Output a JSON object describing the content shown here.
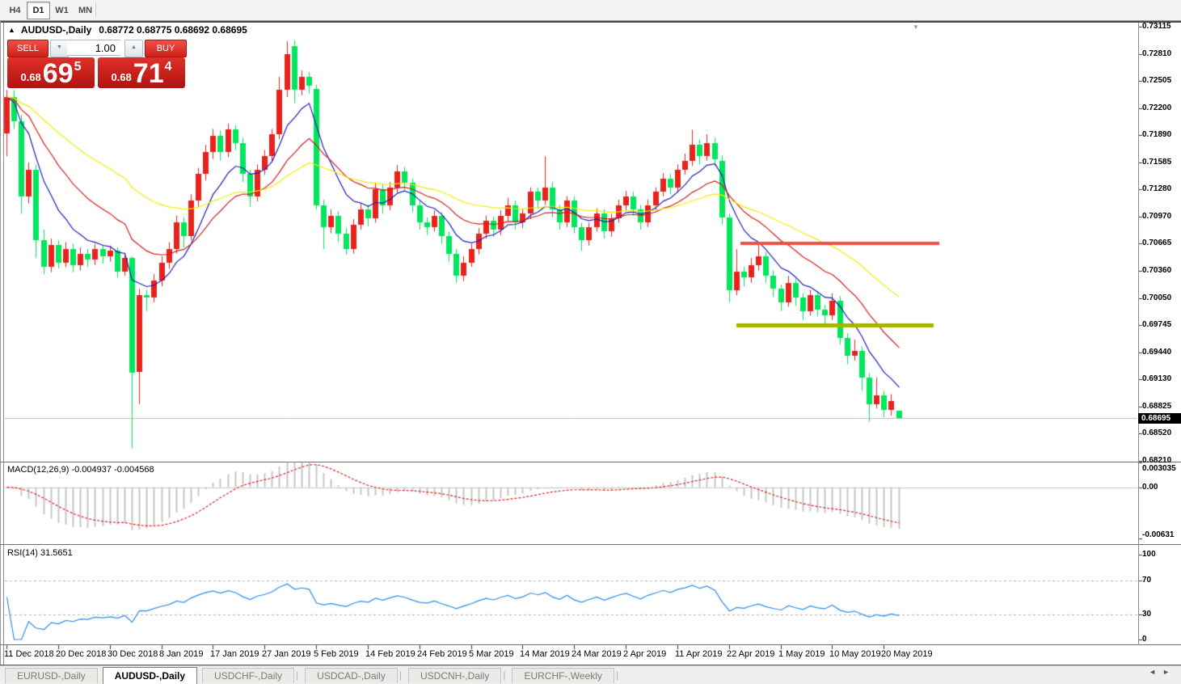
{
  "toolbar": {
    "timeframes": [
      {
        "label": "H4",
        "active": false
      },
      {
        "label": "D1",
        "active": true
      },
      {
        "label": "W1",
        "active": false
      },
      {
        "label": "MN",
        "active": false
      }
    ]
  },
  "chart": {
    "title": "AUDUSD-,Daily",
    "ohlc_text": "0.68772 0.68775 0.68692 0.68695",
    "collapse_icon": "▲",
    "autoscroll_icon": "▼",
    "trade_widget": {
      "sell_label": "SELL",
      "buy_label": "BUY",
      "volume": "1.00",
      "spin_down_icon": "▼",
      "spin_up_icon": "▲",
      "sell_price": "0.68695",
      "buy_price": "0.68714",
      "sell_small": "0.68",
      "sell_big": "69",
      "sell_sup": "5",
      "buy_small": "0.68",
      "buy_big": "71",
      "buy_sup": "4"
    },
    "price_axis": {
      "ticks": [
        "0.73115",
        "0.72810",
        "0.72505",
        "0.72200",
        "0.71890",
        "0.71585",
        "0.71280",
        "0.70970",
        "0.70665",
        "0.70360",
        "0.70050",
        "0.69745",
        "0.69440",
        "0.69130",
        "0.68825",
        "0.68520",
        "0.68210"
      ],
      "current": "0.68695"
    }
  },
  "macd_panel": {
    "label": "MACD(12,26,9) -0.004937 -0.004568",
    "axis_labels": [
      "0.003035",
      "0.00",
      "-0.00631"
    ]
  },
  "rsi_panel": {
    "label": "RSI(14) 31.5651",
    "axis_labels": [
      "100",
      "70",
      "30",
      "0"
    ]
  },
  "tabs": {
    "items": [
      {
        "label": "EURUSD-,Daily",
        "active": false
      },
      {
        "label": "AUDUSD-,Daily",
        "active": true
      },
      {
        "label": "USDCHF-,Daily",
        "active": false
      },
      {
        "label": "USDCAD-,Daily",
        "active": false
      },
      {
        "label": "USDCNH-,Daily",
        "active": false
      },
      {
        "label": "EURCHF-,Weekly",
        "active": false
      }
    ],
    "scroll_left_icon": "◄",
    "scroll_right_icon": "►"
  },
  "chart_data": {
    "type": "candlestick",
    "symbol": "AUDUSD-",
    "timeframe": "Daily",
    "last_bar": {
      "open": 0.68772,
      "high": 0.68775,
      "low": 0.68692,
      "close": 0.68695
    },
    "bid": 0.68695,
    "ask": 0.68714,
    "color_scheme": "red-up-green-down",
    "x_labels": [
      "11 Dec 2018",
      "20 Dec 2018",
      "30 Dec 2018",
      "8 Jan 2019",
      "17 Jan 2019",
      "27 Jan 2019",
      "5 Feb 2019",
      "14 Feb 2019",
      "24 Feb 2019",
      "5 Mar 2019",
      "14 Mar 2019",
      "24 Mar 2019",
      "2 Apr 2019",
      "11 Apr 2019",
      "22 Apr 2019",
      "1 May 2019",
      "10 May 2019",
      "20 May 2019"
    ],
    "bars_per_label": 7,
    "candles": [
      [
        0.7191,
        0.724,
        0.7165,
        0.7232
      ],
      [
        0.7232,
        0.724,
        0.7196,
        0.7205
      ],
      [
        0.7205,
        0.7212,
        0.71,
        0.712
      ],
      [
        0.712,
        0.7158,
        0.7112,
        0.715
      ],
      [
        0.715,
        0.7156,
        0.705,
        0.707
      ],
      [
        0.707,
        0.7082,
        0.7032,
        0.704
      ],
      [
        0.704,
        0.7072,
        0.7034,
        0.7065
      ],
      [
        0.7065,
        0.707,
        0.7038,
        0.7045
      ],
      [
        0.7045,
        0.7068,
        0.704,
        0.706
      ],
      [
        0.706,
        0.7066,
        0.7034,
        0.7042
      ],
      [
        0.7042,
        0.7062,
        0.7036,
        0.7055
      ],
      [
        0.7055,
        0.706,
        0.704,
        0.7048
      ],
      [
        0.7048,
        0.7066,
        0.7042,
        0.706
      ],
      [
        0.706,
        0.7065,
        0.7044,
        0.7052
      ],
      [
        0.7052,
        0.7064,
        0.7046,
        0.7058
      ],
      [
        0.7058,
        0.7062,
        0.7028,
        0.7035
      ],
      [
        0.7035,
        0.7056,
        0.703,
        0.705
      ],
      [
        0.705,
        0.7052,
        0.6835,
        0.692
      ],
      [
        0.6921,
        0.7015,
        0.6885,
        0.7008
      ],
      [
        0.7008,
        0.7014,
        0.699,
        0.7005
      ],
      [
        0.7005,
        0.7032,
        0.7,
        0.7025
      ],
      [
        0.7025,
        0.7052,
        0.7018,
        0.7045
      ],
      [
        0.7045,
        0.7068,
        0.7038,
        0.706
      ],
      [
        0.706,
        0.7098,
        0.7055,
        0.709
      ],
      [
        0.709,
        0.7096,
        0.7062,
        0.7075
      ],
      [
        0.7075,
        0.7122,
        0.707,
        0.7115
      ],
      [
        0.7115,
        0.7152,
        0.7108,
        0.7145
      ],
      [
        0.7145,
        0.7178,
        0.7138,
        0.717
      ],
      [
        0.717,
        0.7196,
        0.7162,
        0.7188
      ],
      [
        0.7188,
        0.7194,
        0.716,
        0.717
      ],
      [
        0.717,
        0.7202,
        0.7164,
        0.7195
      ],
      [
        0.7195,
        0.72,
        0.7172,
        0.718
      ],
      [
        0.718,
        0.7186,
        0.7136,
        0.7145
      ],
      [
        0.7145,
        0.715,
        0.7108,
        0.712
      ],
      [
        0.712,
        0.7156,
        0.7114,
        0.715
      ],
      [
        0.715,
        0.7172,
        0.7144,
        0.7165
      ],
      [
        0.7165,
        0.7196,
        0.7158,
        0.719
      ],
      [
        0.719,
        0.7255,
        0.7184,
        0.724
      ],
      [
        0.724,
        0.7295,
        0.7232,
        0.728
      ],
      [
        0.729,
        0.7296,
        0.7225,
        0.724
      ],
      [
        0.724,
        0.7262,
        0.7234,
        0.7255
      ],
      [
        0.7255,
        0.726,
        0.7236,
        0.7245
      ],
      [
        0.7241,
        0.7246,
        0.7105,
        0.711
      ],
      [
        0.711,
        0.7116,
        0.706,
        0.7085
      ],
      [
        0.7085,
        0.7105,
        0.7078,
        0.7098
      ],
      [
        0.7098,
        0.7103,
        0.7068,
        0.7078
      ],
      [
        0.7078,
        0.7084,
        0.7054,
        0.706
      ],
      [
        0.706,
        0.7094,
        0.7055,
        0.7088
      ],
      [
        0.7088,
        0.7112,
        0.7082,
        0.7105
      ],
      [
        0.7105,
        0.711,
        0.7086,
        0.7095
      ],
      [
        0.7095,
        0.7135,
        0.709,
        0.7128
      ],
      [
        0.7128,
        0.7133,
        0.71,
        0.711
      ],
      [
        0.711,
        0.7136,
        0.7104,
        0.713
      ],
      [
        0.713,
        0.7155,
        0.7124,
        0.7148
      ],
      [
        0.7148,
        0.7153,
        0.7126,
        0.7135
      ],
      [
        0.7135,
        0.714,
        0.7102,
        0.711
      ],
      [
        0.711,
        0.7115,
        0.7082,
        0.709
      ],
      [
        0.709,
        0.7096,
        0.7076,
        0.7085
      ],
      [
        0.7085,
        0.7104,
        0.708,
        0.7098
      ],
      [
        0.7098,
        0.7102,
        0.7066,
        0.7075
      ],
      [
        0.7075,
        0.708,
        0.7046,
        0.7055
      ],
      [
        0.7055,
        0.706,
        0.7022,
        0.703
      ],
      [
        0.703,
        0.7052,
        0.7024,
        0.7045
      ],
      [
        0.7045,
        0.7066,
        0.704,
        0.706
      ],
      [
        0.706,
        0.7084,
        0.7054,
        0.7078
      ],
      [
        0.7078,
        0.7098,
        0.7072,
        0.7092
      ],
      [
        0.7092,
        0.7097,
        0.7074,
        0.7082
      ],
      [
        0.7082,
        0.7104,
        0.7076,
        0.7098
      ],
      [
        0.7098,
        0.7118,
        0.7092,
        0.711
      ],
      [
        0.711,
        0.7115,
        0.7082,
        0.709
      ],
      [
        0.709,
        0.7106,
        0.7084,
        0.71
      ],
      [
        0.71,
        0.713,
        0.7094,
        0.7125
      ],
      [
        0.7125,
        0.713,
        0.7106,
        0.7115
      ],
      [
        0.7115,
        0.7165,
        0.711,
        0.713
      ],
      [
        0.713,
        0.7136,
        0.7096,
        0.7105
      ],
      [
        0.7105,
        0.711,
        0.7082,
        0.709
      ],
      [
        0.709,
        0.712,
        0.7085,
        0.7115
      ],
      [
        0.7115,
        0.712,
        0.7078,
        0.7085
      ],
      [
        0.7085,
        0.709,
        0.7058,
        0.707
      ],
      [
        0.707,
        0.709,
        0.7064,
        0.7085
      ],
      [
        0.7085,
        0.7106,
        0.708,
        0.71
      ],
      [
        0.71,
        0.7105,
        0.7072,
        0.708
      ],
      [
        0.708,
        0.71,
        0.7074,
        0.7095
      ],
      [
        0.7095,
        0.7116,
        0.709,
        0.711
      ],
      [
        0.711,
        0.7126,
        0.7104,
        0.712
      ],
      [
        0.712,
        0.7125,
        0.7098,
        0.7105
      ],
      [
        0.7105,
        0.711,
        0.7082,
        0.709
      ],
      [
        0.709,
        0.7116,
        0.7085,
        0.711
      ],
      [
        0.711,
        0.713,
        0.7104,
        0.7125
      ],
      [
        0.7125,
        0.7146,
        0.712,
        0.714
      ],
      [
        0.714,
        0.7145,
        0.7122,
        0.713
      ],
      [
        0.713,
        0.7156,
        0.7124,
        0.715
      ],
      [
        0.715,
        0.7168,
        0.7144,
        0.716
      ],
      [
        0.716,
        0.7195,
        0.7154,
        0.7178
      ],
      [
        0.7178,
        0.7184,
        0.7156,
        0.7165
      ],
      [
        0.7165,
        0.719,
        0.716,
        0.718
      ],
      [
        0.718,
        0.7186,
        0.7154,
        0.7162
      ],
      [
        0.716,
        0.7166,
        0.7088,
        0.7096
      ],
      [
        0.7096,
        0.71,
        0.7,
        0.7014
      ],
      [
        0.7014,
        0.706,
        0.7008,
        0.7035
      ],
      [
        0.7035,
        0.704,
        0.7018,
        0.7028
      ],
      [
        0.7028,
        0.705,
        0.7022,
        0.7042
      ],
      [
        0.7042,
        0.7065,
        0.7036,
        0.7052
      ],
      [
        0.7052,
        0.7057,
        0.7022,
        0.703
      ],
      [
        0.703,
        0.7036,
        0.7006,
        0.7015
      ],
      [
        0.7015,
        0.702,
        0.699,
        0.7
      ],
      [
        0.7,
        0.703,
        0.6995,
        0.7022
      ],
      [
        0.7022,
        0.7027,
        0.6996,
        0.7005
      ],
      [
        0.7005,
        0.701,
        0.698,
        0.699
      ],
      [
        0.699,
        0.7014,
        0.6985,
        0.7008
      ],
      [
        0.7008,
        0.7013,
        0.6984,
        0.6992
      ],
      [
        0.6992,
        0.6997,
        0.6976,
        0.6985
      ],
      [
        0.6985,
        0.701,
        0.698,
        0.7002
      ],
      [
        0.7002,
        0.7007,
        0.6952,
        0.696
      ],
      [
        0.696,
        0.6965,
        0.693,
        0.694
      ],
      [
        0.694,
        0.6958,
        0.6934,
        0.6945
      ],
      [
        0.6945,
        0.695,
        0.69,
        0.6915
      ],
      [
        0.6915,
        0.692,
        0.6865,
        0.6885
      ],
      [
        0.6885,
        0.6915,
        0.688,
        0.6895
      ],
      [
        0.6895,
        0.69,
        0.687,
        0.6878
      ],
      [
        0.6878,
        0.6896,
        0.6872,
        0.6888
      ],
      [
        0.68772,
        0.68775,
        0.68692,
        0.68695
      ]
    ],
    "moving_averages": [
      {
        "period": 8,
        "color": "#1d1db8"
      },
      {
        "period": 18,
        "color": "#d41c1c"
      },
      {
        "period": 40,
        "color": "#f0ee00"
      }
    ],
    "hlines": [
      {
        "price": 0.70665,
        "color": "#ee4f45",
        "thickness": 4
      },
      {
        "price": 0.69745,
        "color": "#a6b400",
        "thickness": 5
      }
    ],
    "indicators": [
      {
        "name": "MACD",
        "params": [
          12,
          26,
          9
        ],
        "current_values": [
          -0.004937,
          -0.004568
        ],
        "scale_max": 0.003035,
        "scale_min": -0.00631,
        "histogram_color": "#c6c6c6",
        "signal_color": "#e02020"
      },
      {
        "name": "RSI",
        "params": [
          14
        ],
        "current_value": 31.5651,
        "levels": [
          70,
          30
        ],
        "scale": [
          0,
          100
        ],
        "line_color": "#2e8be6"
      }
    ],
    "y_ticks": [
      0.73115,
      0.7281,
      0.72505,
      0.722,
      0.7189,
      0.71585,
      0.7128,
      0.7097,
      0.70665,
      0.7036,
      0.7005,
      0.69745,
      0.6944,
      0.6913,
      0.68825,
      0.6852,
      0.6821
    ],
    "current_price": 0.68695,
    "colors": {
      "up_body": "#e8231c",
      "down_body": "#00e65c",
      "current_line": "#bdbdbd",
      "level_dash": "#b0b0b0",
      "zero_line": "#c8c8c8"
    }
  }
}
